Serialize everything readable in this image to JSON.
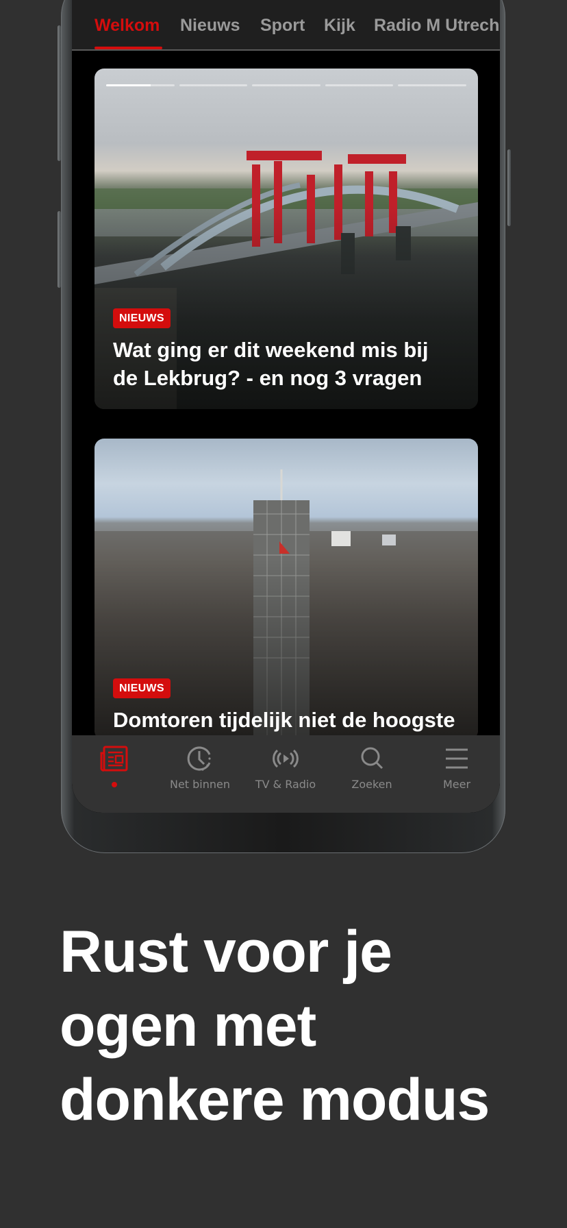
{
  "tabs": [
    {
      "label": "Welkom",
      "active": true
    },
    {
      "label": "Nieuws",
      "active": false
    },
    {
      "label": "Sport",
      "active": false
    },
    {
      "label": "Kijk",
      "active": false
    },
    {
      "label": "Radio M Utrech",
      "active": false
    }
  ],
  "stories": {
    "segments": 5,
    "current_index": 0,
    "current_progress": 0.65
  },
  "articles": [
    {
      "category": "NIEUWS",
      "title_lines": [
        "Wat ging er dit weekend mis bij",
        "de Lekbrug? - en nog 3 vragen"
      ]
    },
    {
      "category": "NIEUWS",
      "title_lines": [
        "Domtoren tijdelijk niet de hoogste"
      ]
    }
  ],
  "bottom_nav": {
    "items": [
      {
        "label": "",
        "icon": "newspaper-icon",
        "active": true
      },
      {
        "label": "Net binnen",
        "icon": "clock-icon",
        "active": false
      },
      {
        "label": "TV & Radio",
        "icon": "broadcast-play-icon",
        "active": false
      },
      {
        "label": "Zoeken",
        "icon": "search-icon",
        "active": false
      },
      {
        "label": "Meer",
        "icon": "menu-icon",
        "active": false
      }
    ]
  },
  "promo": {
    "lines": [
      "Rust voor je",
      "ogen met",
      "donkere modus"
    ]
  },
  "colors": {
    "accent": "#d40d0d",
    "background": "#303030",
    "inactive": "#8a8a8a"
  }
}
